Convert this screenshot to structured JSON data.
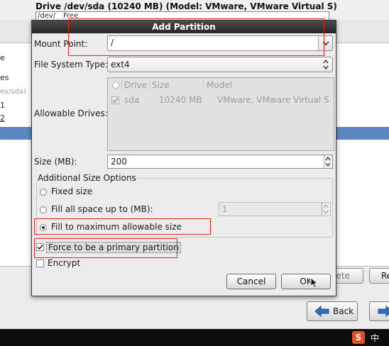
{
  "background": {
    "drive_title": "Drive /dev/sda (10240 MB) (Model: VMware, VMware Virtual S)",
    "strip_cells": [
      "/dev/",
      "Free"
    ],
    "list_items": [
      "e",
      "es",
      "ev/sda)",
      "1",
      "2"
    ],
    "buttons": {
      "delete_label": "lete",
      "reset_label": "Re"
    },
    "nav": {
      "back_label": "Back"
    },
    "tray": {
      "s_label": "S",
      "lang_label": "中"
    }
  },
  "dialog": {
    "title": "Add Partition",
    "mount_point": {
      "label": "Mount Point:",
      "value": "/"
    },
    "fs_type": {
      "label": "File System Type:",
      "value": "ext4"
    },
    "allowable_drives": {
      "label": "Allowable Drives:",
      "columns": [
        "Drive",
        "Size",
        "Model"
      ],
      "rows": [
        {
          "drive": "sda",
          "size": "10240 MB",
          "model": "VMware, VMware Virtual S",
          "checked": true
        }
      ]
    },
    "size": {
      "label": "Size (MB):",
      "value": "200"
    },
    "additional": {
      "legend": "Additional Size Options",
      "options": [
        {
          "label": "Fixed size",
          "selected": false
        },
        {
          "label": "Fill all space up to (MB):",
          "selected": false
        },
        {
          "label": "Fill to maximum allowable size",
          "selected": true
        }
      ],
      "fill_up_to_value": "1"
    },
    "force_primary": {
      "label": "Force to be a primary partition",
      "checked": true
    },
    "encrypt": {
      "label": "Encrypt",
      "checked": false
    },
    "buttons": {
      "cancel_label": "Cancel",
      "ok_label": "OK"
    }
  },
  "colors": {
    "highlight_box": "#e0261e",
    "selection_row": "#5d87c2",
    "titlebar": "#2e2e2e"
  }
}
